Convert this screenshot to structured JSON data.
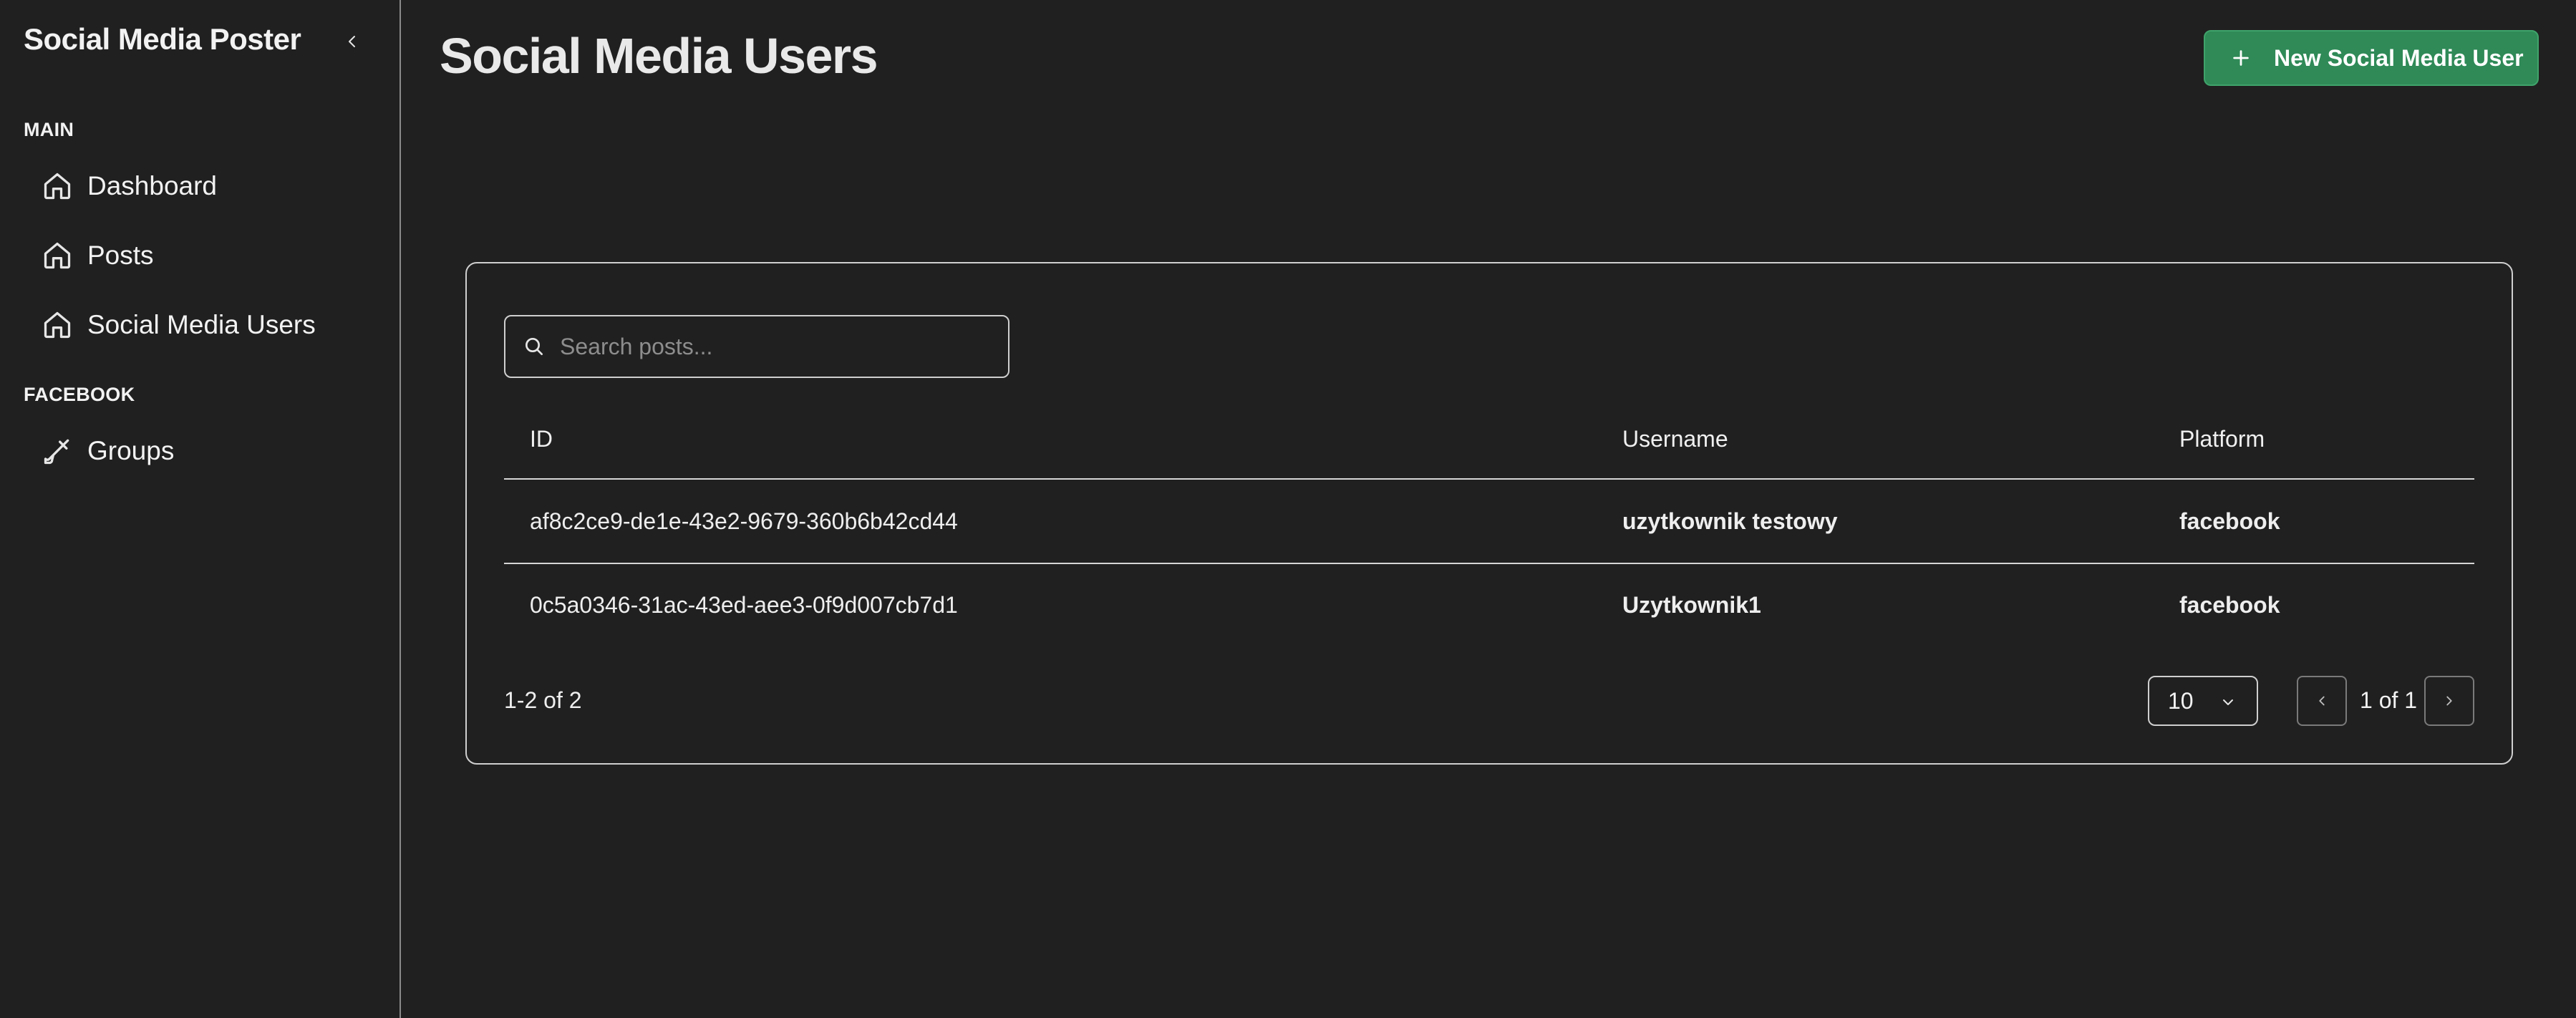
{
  "sidebar": {
    "app_title": "Social Media Poster",
    "sections": [
      {
        "label": "MAIN",
        "items": [
          {
            "label": "Dashboard",
            "icon": "home-icon"
          },
          {
            "label": "Posts",
            "icon": "home-icon"
          },
          {
            "label": "Social Media Users",
            "icon": "home-icon"
          }
        ]
      },
      {
        "label": "FACEBOOK",
        "items": [
          {
            "label": "Groups",
            "icon": "brush-icon"
          }
        ]
      }
    ]
  },
  "header": {
    "title": "Social Media Users",
    "new_button_label": "New Social Media User",
    "new_button_color": "#2f8a57"
  },
  "search": {
    "placeholder": "Search posts...",
    "value": ""
  },
  "table": {
    "columns": [
      "ID",
      "Username",
      "Platform"
    ],
    "rows": [
      {
        "id": "af8c2ce9-de1e-43e2-9679-360b6b42cd44",
        "username": "uzytkownik testowy",
        "platform": "facebook"
      },
      {
        "id": "0c5a0346-31ac-43ed-aee3-0f9d007cb7d1",
        "username": "Uzytkownik1",
        "platform": "facebook"
      }
    ]
  },
  "pagination": {
    "range_text": "1-2 of 2",
    "page_size": "10",
    "page_text": "1 of 1"
  }
}
